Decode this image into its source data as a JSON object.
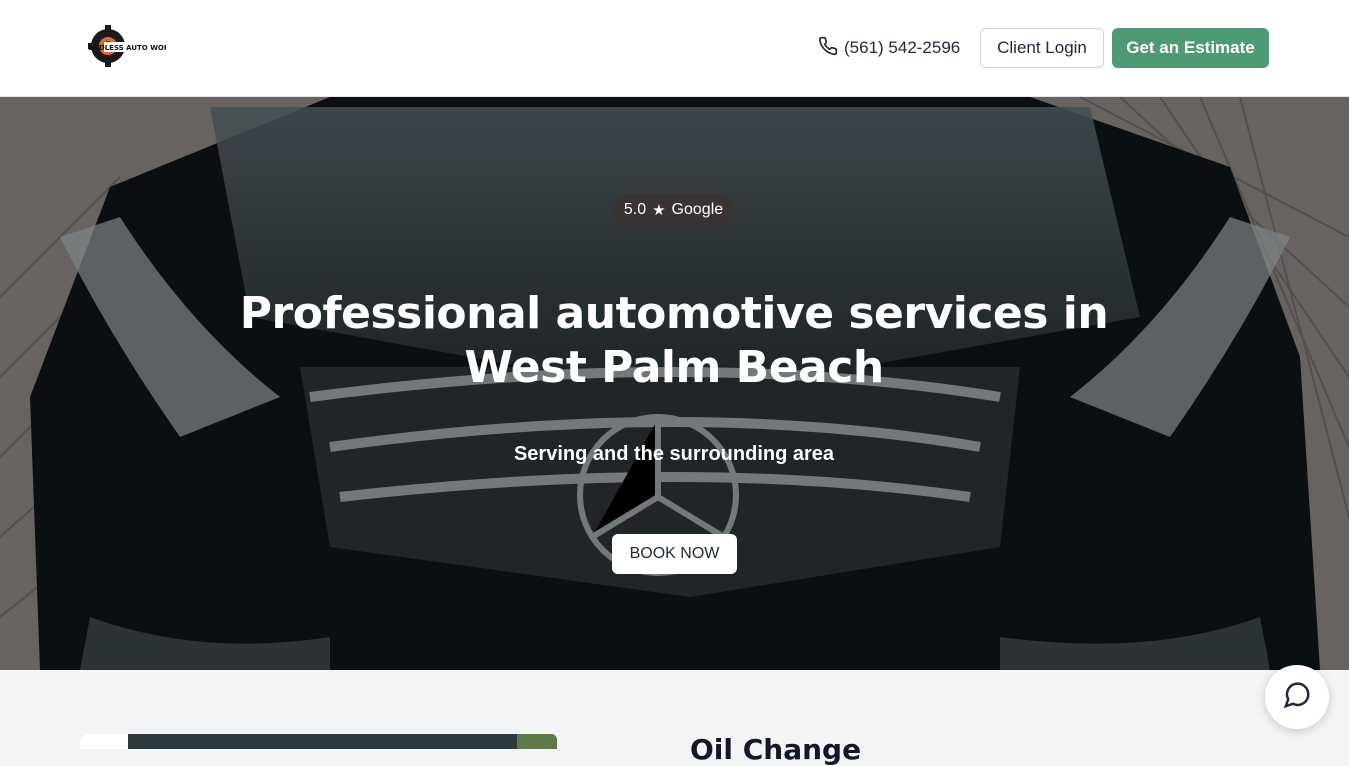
{
  "header": {
    "logo_text": "ENDLESS AUTO WORKS",
    "phone": "(561) 542-2596",
    "login_label": "Client Login",
    "estimate_label": "Get an Estimate"
  },
  "hero": {
    "rating_score": "5.0",
    "rating_source": "Google",
    "title": "Professional automotive services in West Palm Beach",
    "subtitle": "Serving and the surrounding area",
    "book_label": "BOOK NOW"
  },
  "section": {
    "title": "Oil Change"
  },
  "colors": {
    "accent": "#4e9a72",
    "header_bg": "#ffffff",
    "section_bg": "#f3f4f6"
  },
  "icons": {
    "phone": "phone-icon",
    "star": "star-icon",
    "chat": "chat-bubble-icon"
  }
}
